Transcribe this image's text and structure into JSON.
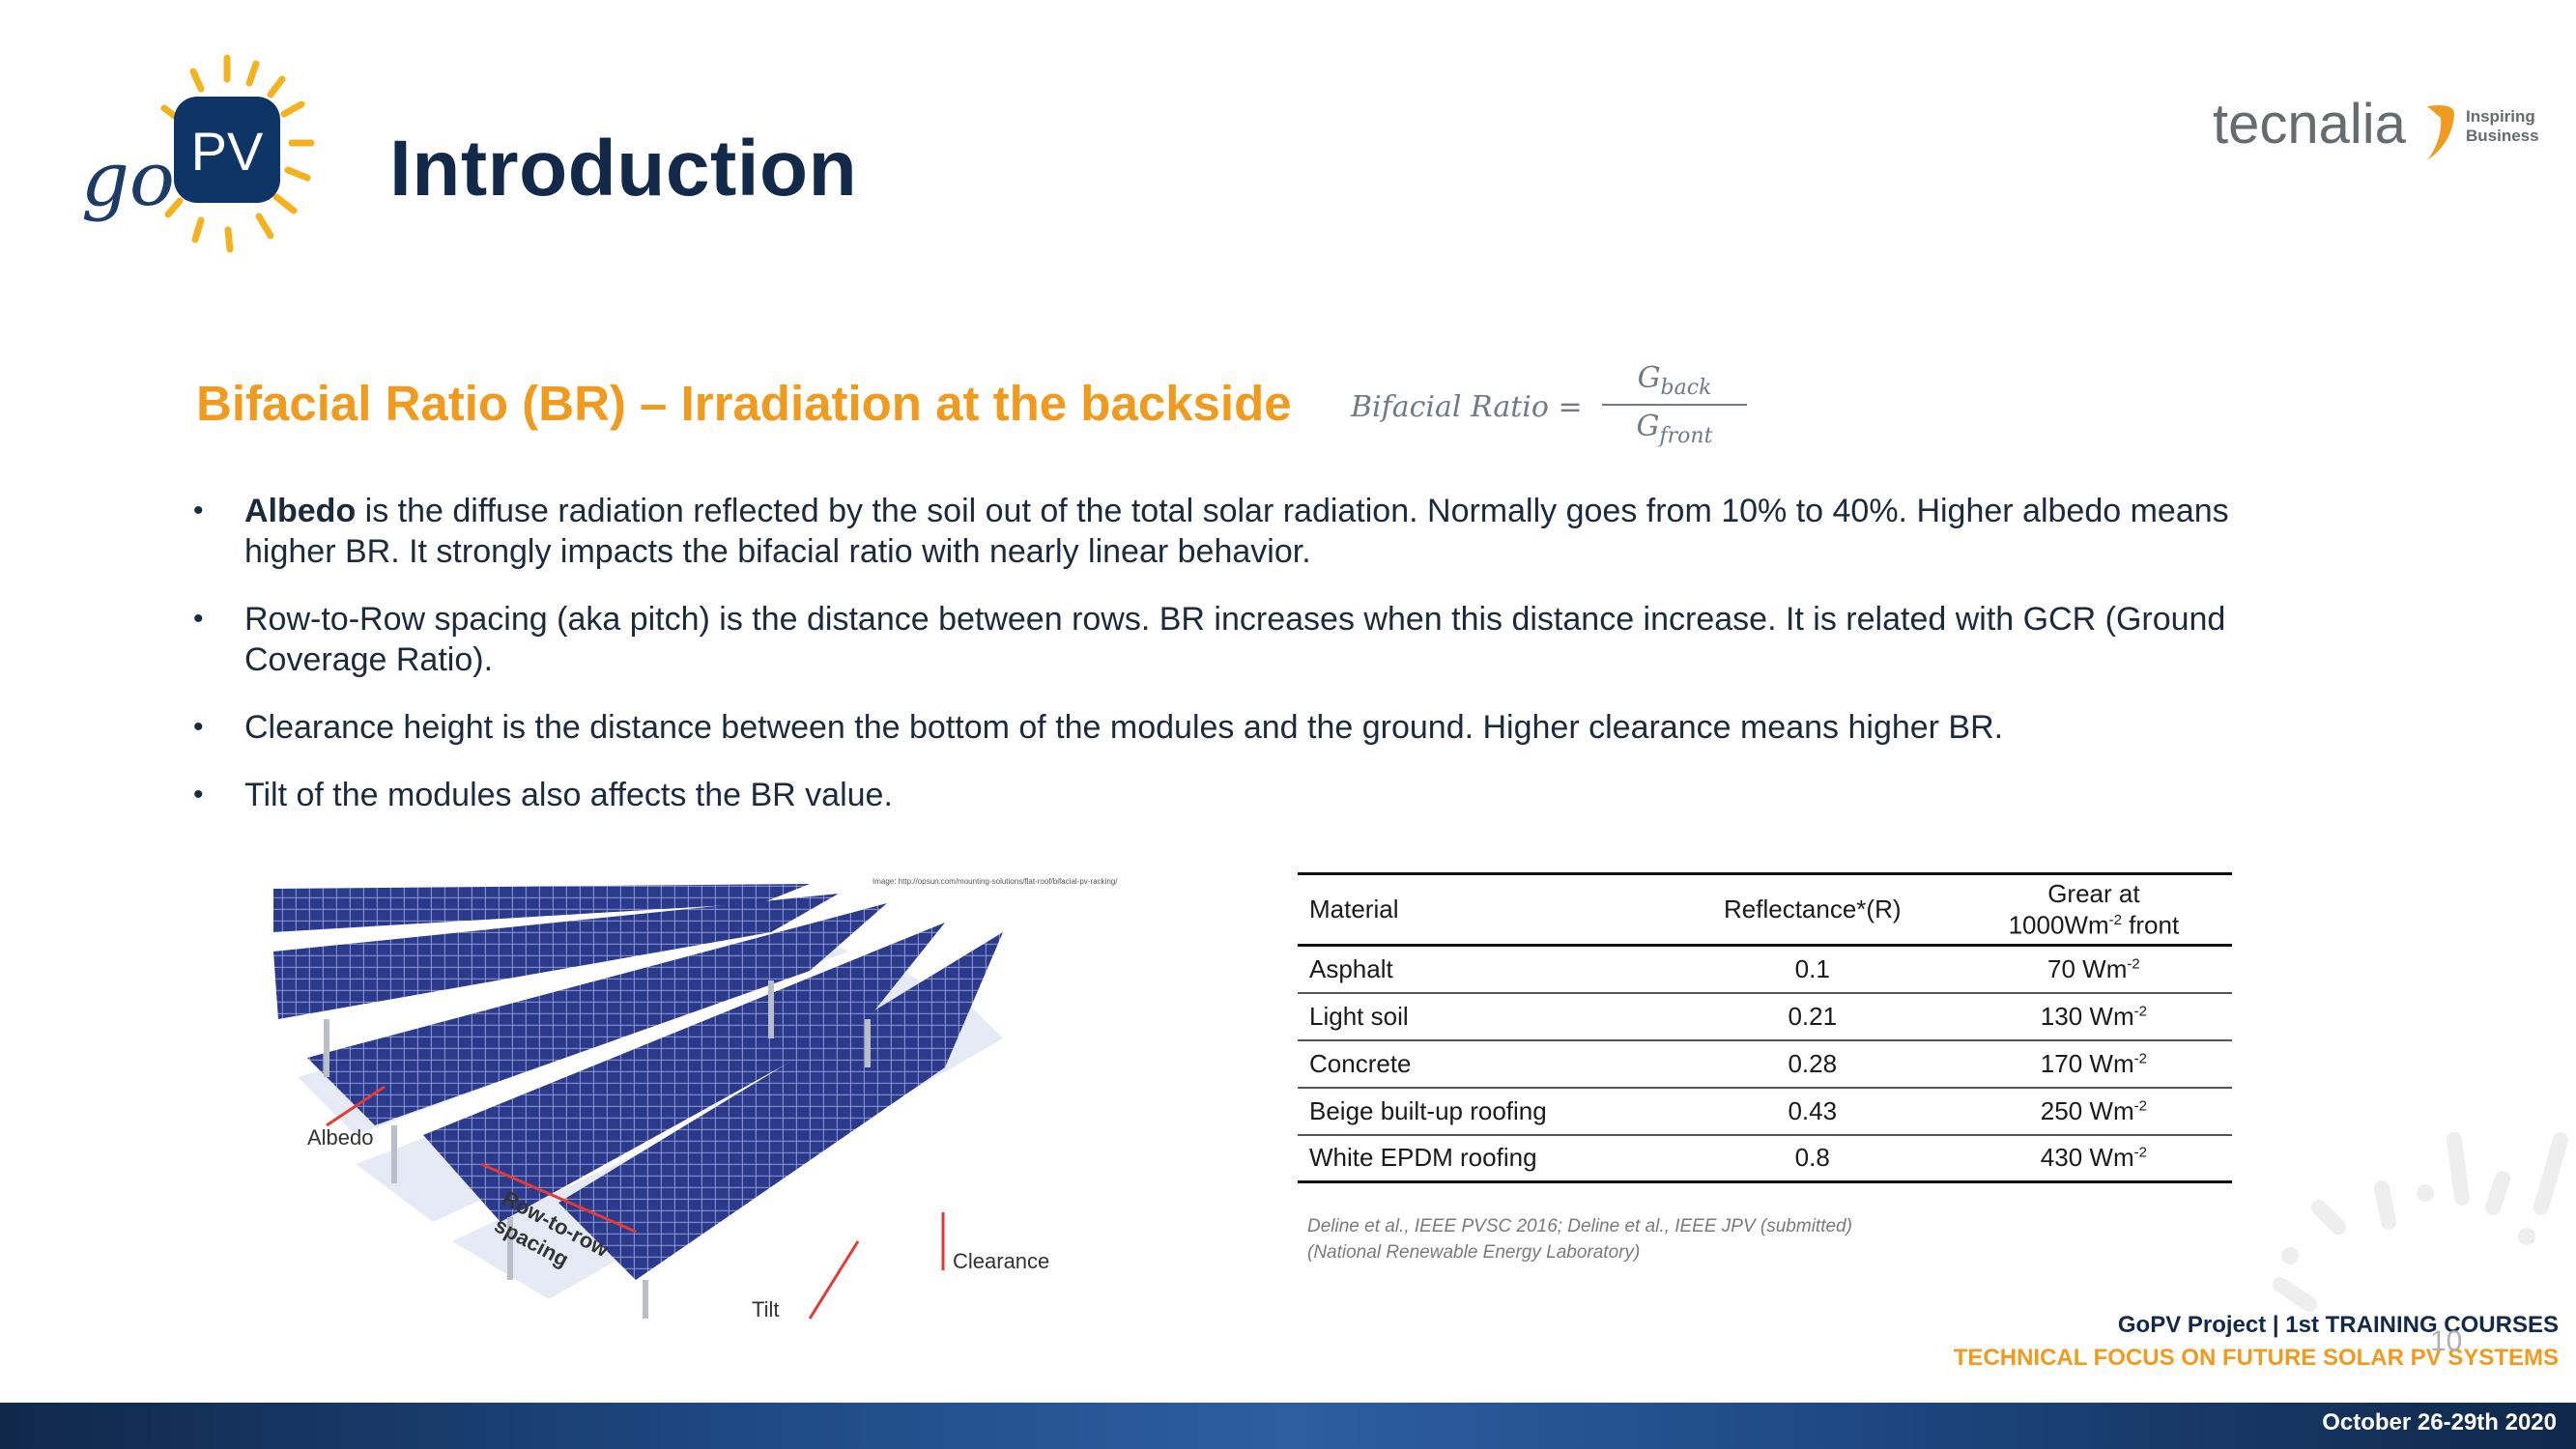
{
  "header": {
    "logo_text_go": "go",
    "logo_text_pv": "PV",
    "title": "Introduction",
    "partner_logo": "tecnalia",
    "partner_tagline_1": "Inspiring",
    "partner_tagline_2": "Business"
  },
  "section": {
    "title": "Bifacial Ratio (BR) – Irradiation at the backside",
    "formula_lhs": "Bifacial Ratio =",
    "formula_num_main": "G",
    "formula_num_sub": "back",
    "formula_den_main": "G",
    "formula_den_sub": "front"
  },
  "bullets": [
    {
      "bold": "Albedo",
      "text": " is the diffuse radiation reflected by the soil out of the total solar radiation. Normally goes from 10% to 40%. Higher albedo means higher BR.  It strongly impacts the bifacial ratio with nearly linear behavior."
    },
    {
      "bold": "",
      "text": "Row-to-Row spacing (aka pitch) is the distance between rows. BR increases when this distance increase. It is related with GCR (Ground Coverage Ratio)."
    },
    {
      "bold": "",
      "text": "Clearance height is the distance between the bottom of the modules and the ground. Higher clearance means higher BR."
    },
    {
      "bold": "",
      "text": "Tilt of the modules also affects the BR value."
    }
  ],
  "image": {
    "label_albedo": "Albedo",
    "label_row1": "Row-to-row",
    "label_row2": "spacing",
    "label_clearance": "Clearance",
    "label_tilt": "Tilt",
    "credit": "Image: http://opsun.com/mounting-solutions/flat-roof/bifacial-pv-racking/"
  },
  "table": {
    "headers": [
      "Material",
      "Reflectance*(R)",
      "Grear at 1000Wm-2 front"
    ],
    "header3_line1": "Grear at",
    "header3_line2": "1000Wm",
    "header3_sup": "-2",
    "header3_line2_end": " front",
    "rows": [
      {
        "material": "Asphalt",
        "reflectance": "0.1",
        "grear": "70 Wm",
        "sup": "-2"
      },
      {
        "material": "Light soil",
        "reflectance": "0.21",
        "grear": "130 Wm",
        "sup": "-2"
      },
      {
        "material": "Concrete",
        "reflectance": "0.28",
        "grear": "170 Wm",
        "sup": "-2"
      },
      {
        "material": "Beige built-up roofing",
        "reflectance": "0.43",
        "grear": "250 Wm",
        "sup": "-2"
      },
      {
        "material": "White EPDM roofing",
        "reflectance": "0.8",
        "grear": "430 Wm",
        "sup": "-2"
      }
    ],
    "source_line1": "Deline et al., IEEE PVSC 2016; Deline et al., IEEE JPV (submitted)",
    "source_line2": "(National Renewable Energy Laboratory)"
  },
  "footer": {
    "line1": "GoPV Project | 1st TRAINING COURSES",
    "line2": "TECHNICAL FOCUS ON FUTURE SOLAR PV SYSTEMS",
    "page_number": "10",
    "date": "October 26-29th 2020"
  },
  "colors": {
    "accent_orange": "#f09a1e",
    "navy": "#12294a",
    "bar_blue": "#2e5ea0"
  }
}
